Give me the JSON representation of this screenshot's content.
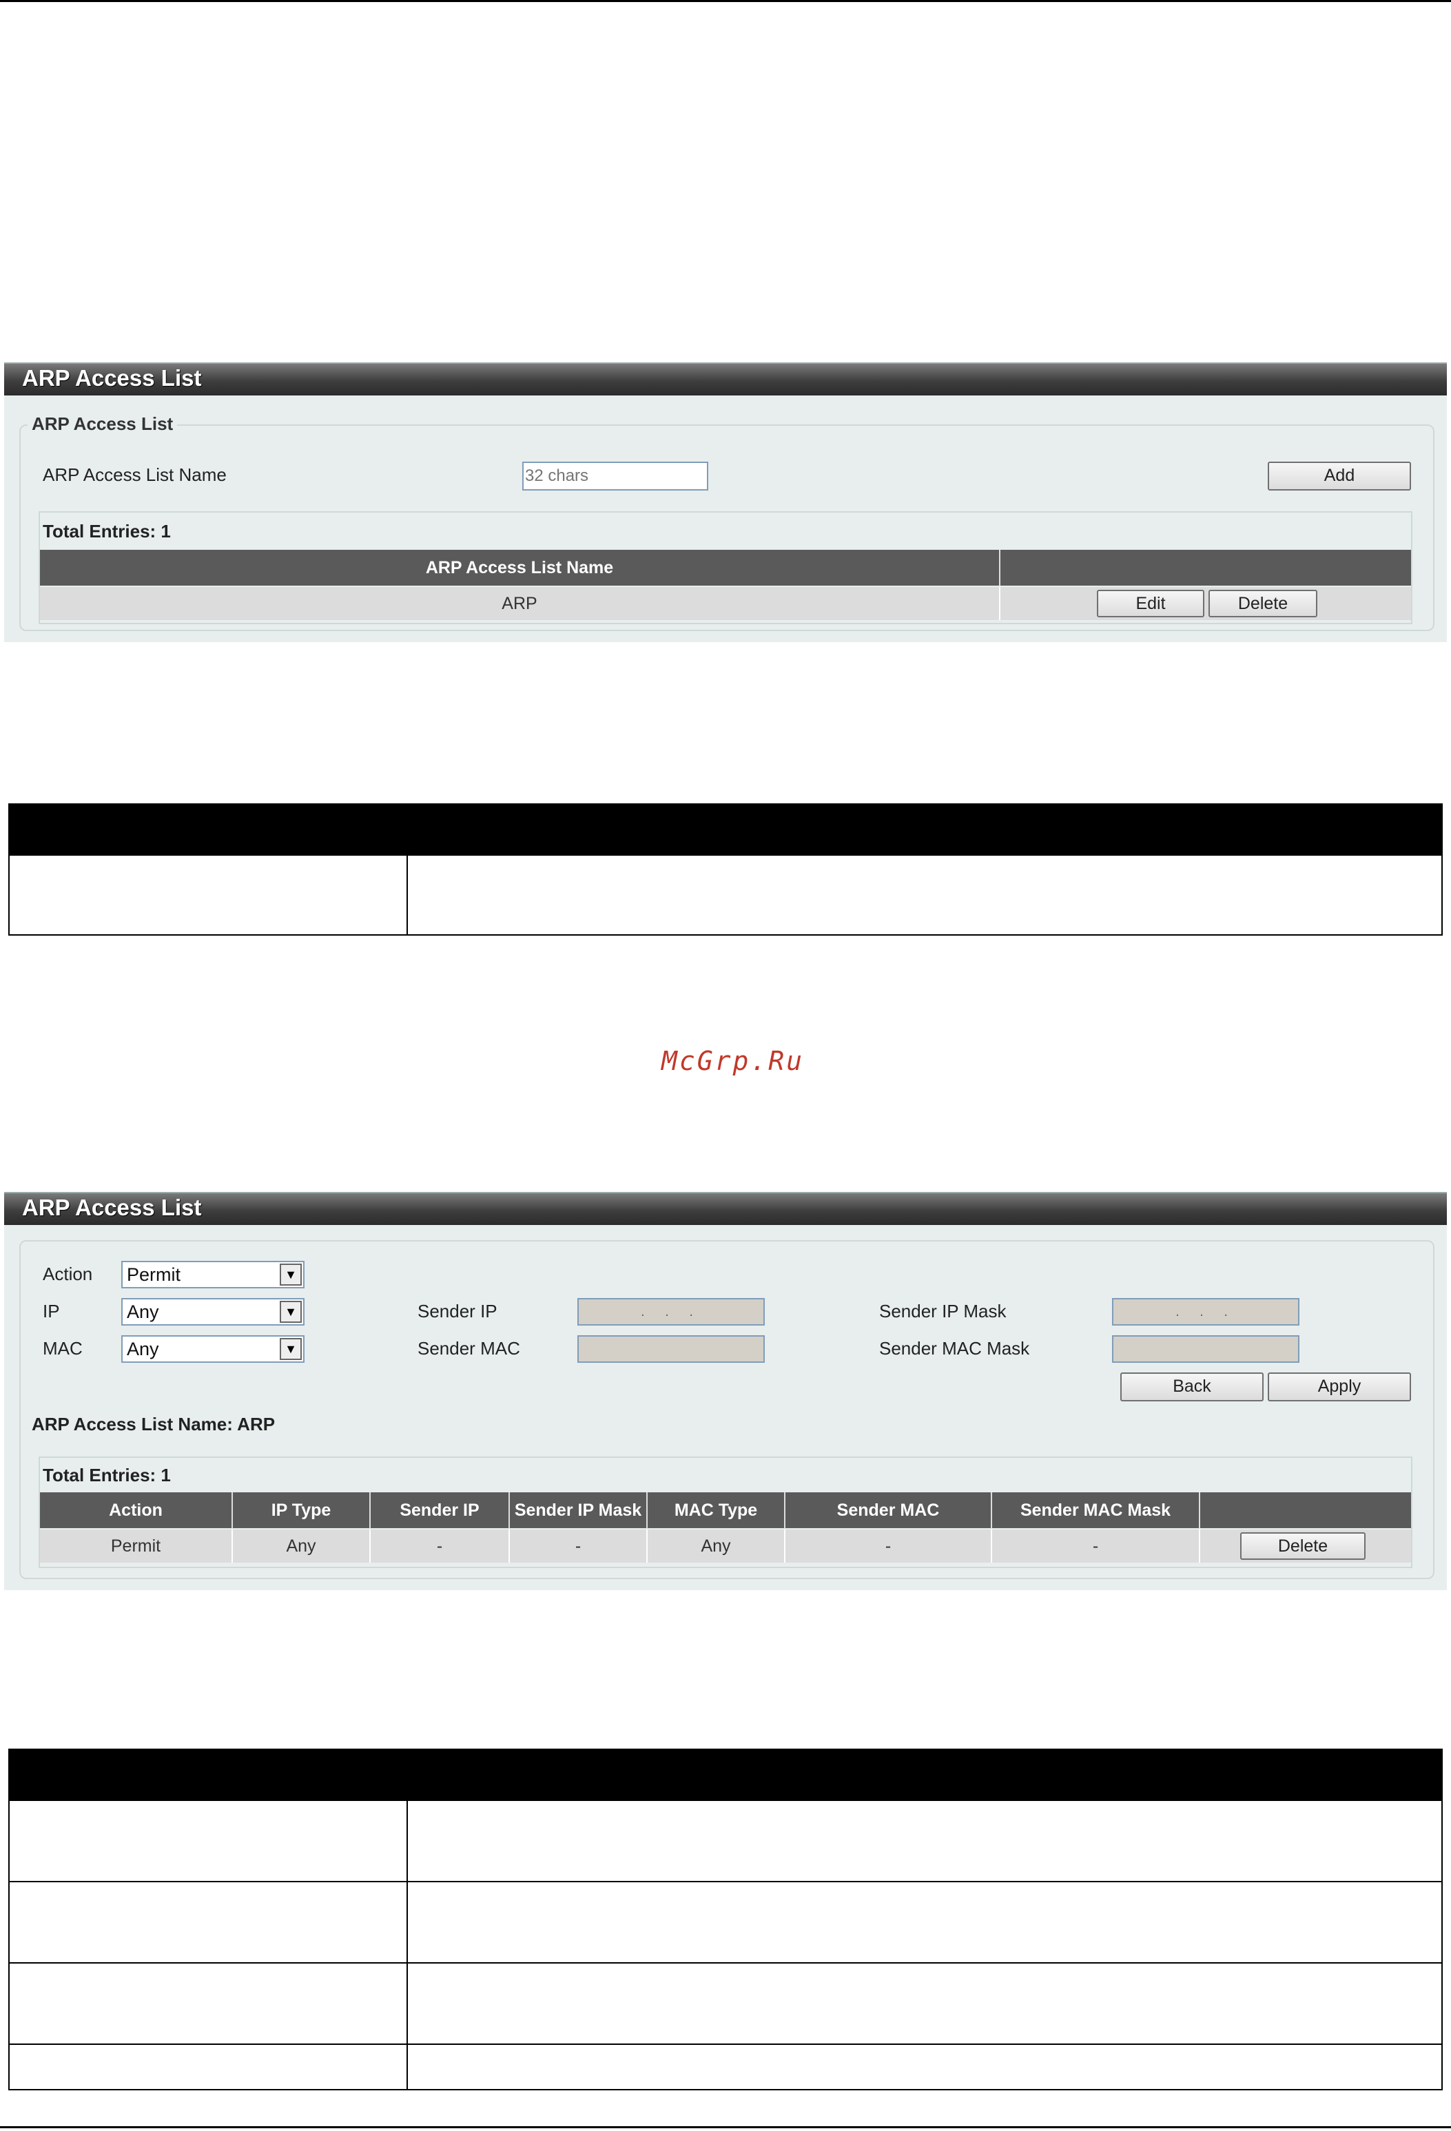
{
  "watermark": "McGrp.Ru",
  "panel1": {
    "title": "ARP Access List",
    "fieldset_legend": "ARP Access List",
    "name_label": "ARP Access List Name",
    "name_placeholder": "32 chars",
    "add_label": "Add",
    "total_entries": "Total Entries: 1",
    "table": {
      "headers": [
        "ARP Access List Name",
        ""
      ],
      "rows": [
        {
          "name": "ARP",
          "edit_label": "Edit",
          "delete_label": "Delete"
        }
      ]
    }
  },
  "panel2": {
    "title": "ARP Access List",
    "action_label": "Action",
    "action_value": "Permit",
    "ip_label": "IP",
    "ip_value": "Any",
    "mac_label": "MAC",
    "mac_value": "Any",
    "sender_ip_label": "Sender IP",
    "sender_ip_value": ". . .",
    "sender_ip_mask_label": "Sender IP Mask",
    "sender_ip_mask_value": ". . .",
    "sender_mac_label": "Sender MAC",
    "sender_mac_mask_label": "Sender MAC Mask",
    "back_label": "Back",
    "apply_label": "Apply",
    "list_name": "ARP Access List Name: ARP",
    "total_entries": "Total Entries: 1",
    "table": {
      "headers": [
        "Action",
        "IP Type",
        "Sender IP",
        "Sender IP Mask",
        "MAC Type",
        "Sender MAC",
        "Sender MAC Mask",
        ""
      ],
      "rows": [
        {
          "action": "Permit",
          "ip_type": "Any",
          "sender_ip": "-",
          "sender_ip_mask": "-",
          "mac_type": "Any",
          "sender_mac": "-",
          "sender_mac_mask": "-",
          "delete_label": "Delete"
        }
      ]
    }
  }
}
